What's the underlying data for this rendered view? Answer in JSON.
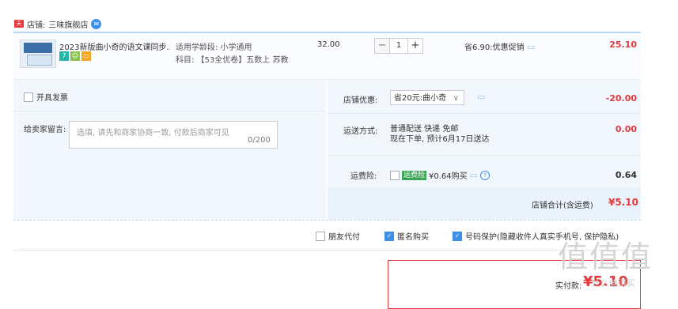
{
  "shop": {
    "icon": "天猫",
    "label": "店铺:",
    "name": "三味旗舰店",
    "chat_icon": "chat-bubble"
  },
  "item": {
    "title": "2023新版曲小奇的语文课同步...",
    "badges": [
      "7",
      "☺",
      "▭"
    ],
    "attr1": "适用学龄段: 小学通用",
    "attr2": "科目: 【53全优卷】五数上 苏教",
    "price": "32.00",
    "qty": "1",
    "minus": "−",
    "plus": "+",
    "promo": "省6.90:优惠促销",
    "subtotal": "25.10"
  },
  "invoice": {
    "label": "开具发票"
  },
  "message": {
    "label": "给卖家留言:",
    "placeholder": "选填, 请先和商家协商一致, 付款后商家可见",
    "count": "0/200"
  },
  "coupon": {
    "label": "店铺优惠:",
    "value": "省20元:曲小奇",
    "arrow": "∨",
    "discount": "-20.00"
  },
  "shipping": {
    "label": "运送方式:",
    "line1": "普通配送 快递 免邮",
    "line2": "现在下单, 预计6月17日送达",
    "fee": "0.00"
  },
  "insurance": {
    "label": "运费险:",
    "tag": "运费险",
    "text": "¥0.64购买",
    "fee": "0.64"
  },
  "store_total": {
    "label": "店铺合计(含运费)",
    "value": "¥5.10"
  },
  "options": {
    "friend_pay": "朋友代付",
    "anonymous": "匿名购买",
    "number_protect": "号码保护(隐藏收件人真实手机号, 保护隐私)"
  },
  "payment": {
    "label": "实付款:",
    "value": "¥5.10"
  },
  "watermark": {
    "text": "值值值",
    "url": "什么值得买"
  },
  "colors": {
    "accent": "#e4393c",
    "blue": "#3d8fe8",
    "panel": "#f2f7fd"
  }
}
